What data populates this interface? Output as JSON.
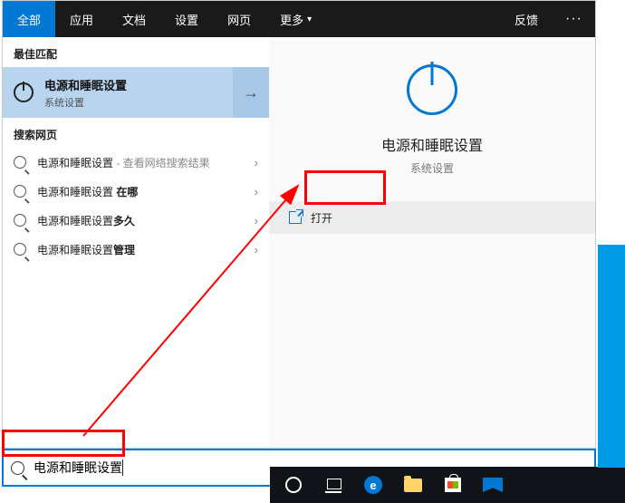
{
  "tabs": {
    "all": "全部",
    "apps": "应用",
    "docs": "文档",
    "settings": "设置",
    "web": "网页",
    "more": "更多",
    "feedback": "反馈"
  },
  "sections": {
    "best_match": "最佳匹配",
    "search_web": "搜索网页"
  },
  "best_match": {
    "title": "电源和睡眠设置",
    "subtitle": "系统设置"
  },
  "web_results": [
    {
      "prefix": "电源和睡眠设置",
      "suffix": " - 查看网络搜索结果",
      "suffix_gray": true
    },
    {
      "prefix": "电源和睡眠设置 ",
      "suffix": "在哪",
      "suffix_bold": true
    },
    {
      "prefix": "电源和睡眠设置",
      "suffix": "多久",
      "suffix_bold": true
    },
    {
      "prefix": "电源和睡眠设置",
      "suffix": "管理",
      "suffix_bold": true
    }
  ],
  "detail": {
    "title": "电源和睡眠设置",
    "subtitle": "系统设置",
    "open": "打开"
  },
  "search": {
    "value": "电源和睡眠设置"
  }
}
